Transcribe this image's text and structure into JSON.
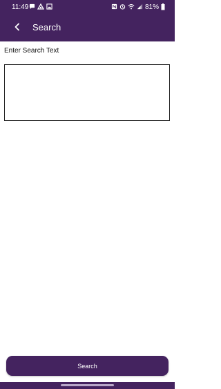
{
  "status_bar": {
    "time": "11:49",
    "battery": "81%",
    "left_icons": [
      "chat-bubble-icon",
      "sync-icon",
      "gallery-icon"
    ],
    "right_icons": [
      "nfc-icon",
      "alarm-icon",
      "wifi-icon",
      "signal-icon",
      "battery-icon"
    ]
  },
  "app_bar": {
    "title": "Search",
    "back_icon": "chevron-left-icon"
  },
  "form": {
    "label": "Enter Search Text",
    "input_value": "",
    "submit_label": "Search"
  },
  "theme": {
    "primary": "#44235f",
    "on_primary": "#ffffff",
    "background": "#ffffff"
  }
}
